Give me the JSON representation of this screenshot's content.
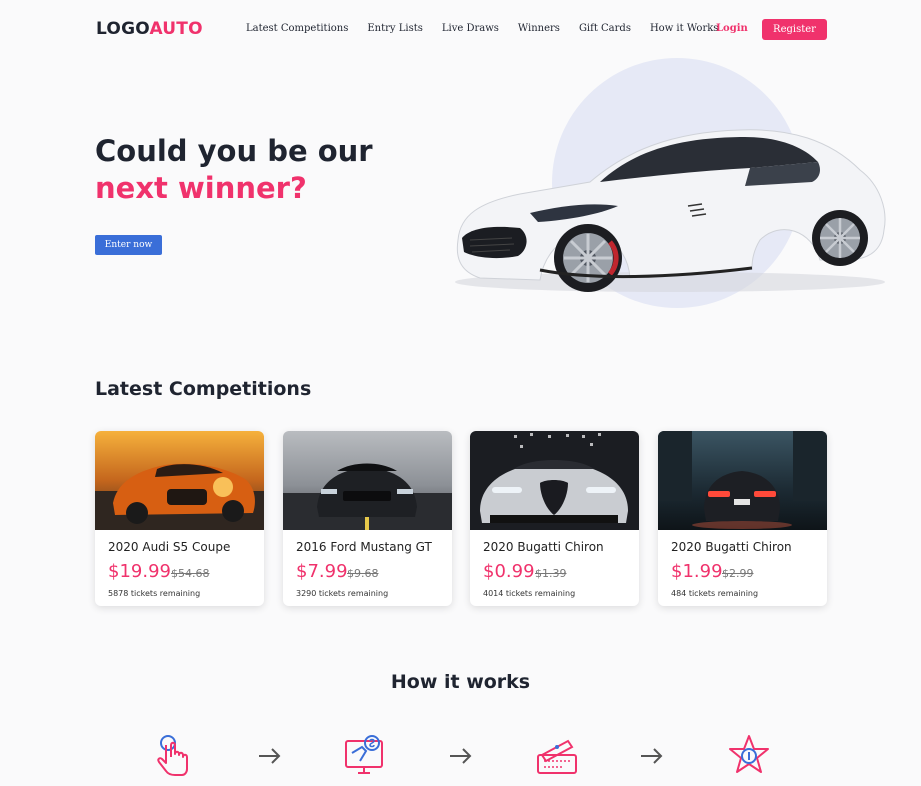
{
  "nav": {
    "logo_part1": "LOGO",
    "logo_part2": "AUTO",
    "menu": [
      "Latest Competitions",
      "Entry Lists",
      "Live Draws",
      "Winners",
      "Gift Cards",
      "How it Works"
    ],
    "login": "Login",
    "register": "Register"
  },
  "hero": {
    "title_line1": "Could you be our",
    "title_line2": "next winner?",
    "cta": "Enter now"
  },
  "competitions": {
    "title": "Latest Competitions",
    "items": [
      {
        "name": "2020 Audi S5 Coupe",
        "price": "$19.99",
        "old_price": "$54.68",
        "remaining": "5878 tickets remaining"
      },
      {
        "name": "2016 Ford Mustang GT",
        "price": "$7.99",
        "old_price": "$9.68",
        "remaining": "3290 tickets remaining"
      },
      {
        "name": "2020 Bugatti Chiron",
        "price": "$0.99",
        "old_price": "$1.39",
        "remaining": "4014 tickets remaining"
      },
      {
        "name": "2020 Bugatti Chiron",
        "price": "$1.99",
        "old_price": "$2.99",
        "remaining": "484 tickets remaining"
      }
    ]
  },
  "how_it_works": {
    "title": "How it works",
    "steps": [
      "tap-hand-icon",
      "computer-payment-icon",
      "ticket-icon",
      "star-medal-icon"
    ]
  },
  "colors": {
    "accent": "#f0326c",
    "primary_blue": "#3a6ed8",
    "dark_text": "#1f2430"
  }
}
